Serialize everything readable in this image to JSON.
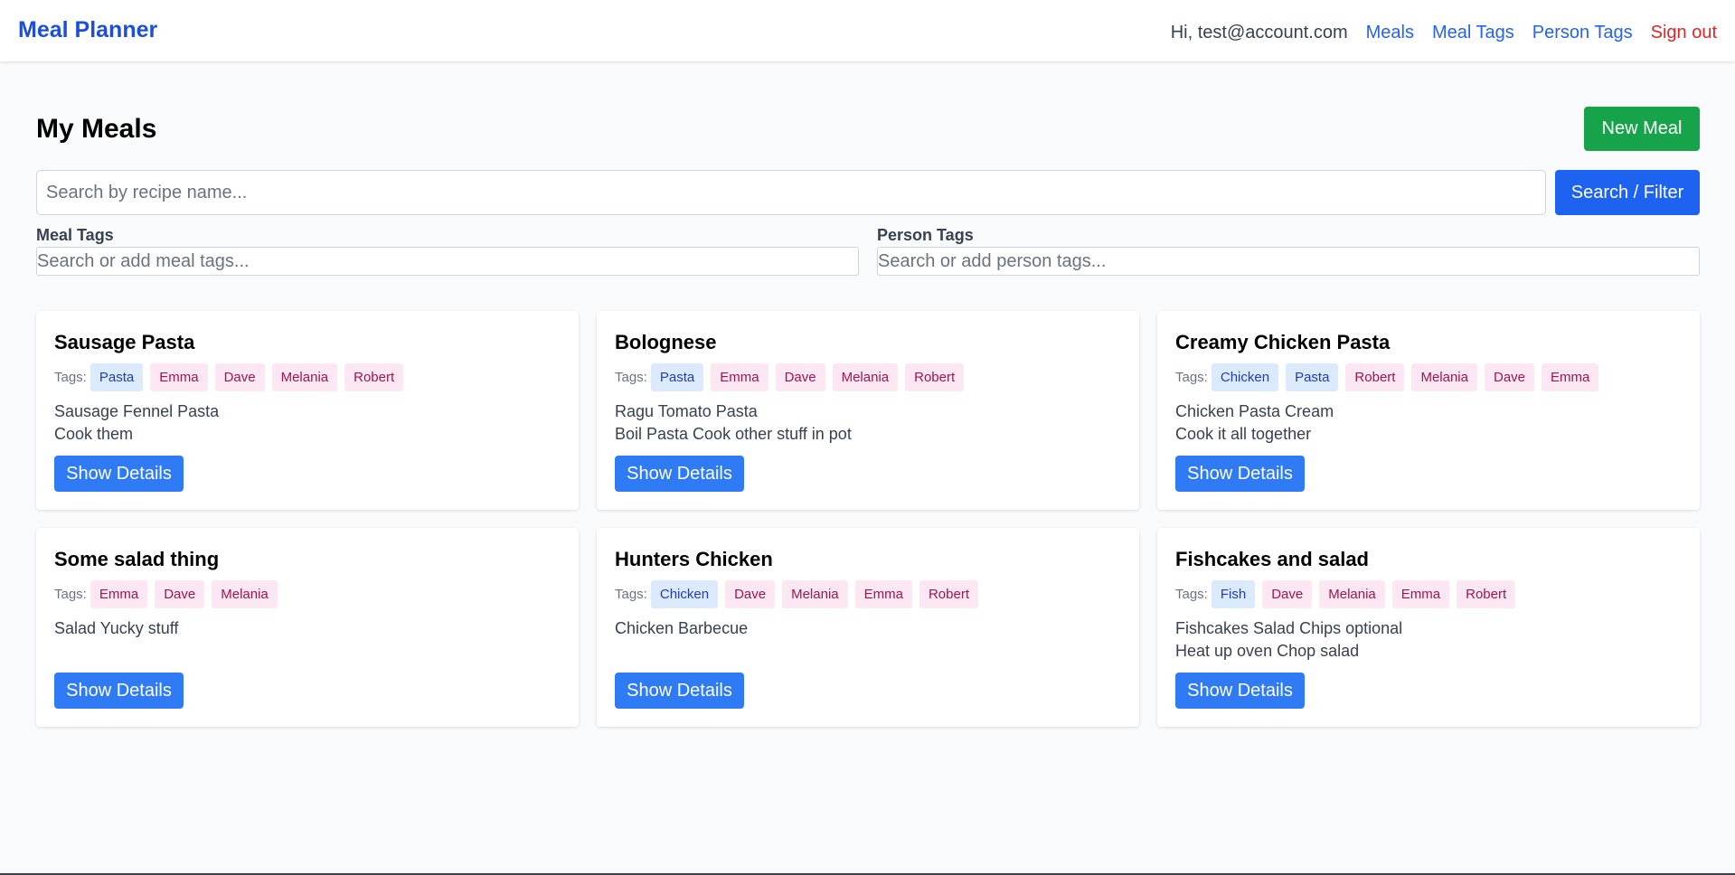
{
  "navbar": {
    "brand": "Meal Planner",
    "greeting": "Hi, test@account.com",
    "links": [
      "Meals",
      "Meal Tags",
      "Person Tags"
    ],
    "signout": "Sign out"
  },
  "page": {
    "title": "My Meals",
    "new_meal_label": "New Meal"
  },
  "search": {
    "placeholder": "Search by recipe name...",
    "value": "",
    "button_label": "Search / Filter"
  },
  "filters": {
    "meal_tags_label": "Meal Tags",
    "meal_tags_placeholder": "Search or add meal tags...",
    "person_tags_label": "Person Tags",
    "person_tags_placeholder": "Search or add person tags..."
  },
  "colors": {
    "accent": "#2563eb",
    "new_button": "#16a34a",
    "signout": "#dc2626",
    "meal_tag_bg": "#dbeafe",
    "person_tag_bg": "#fce7f3"
  },
  "meals": [
    {
      "title": "Sausage Pasta",
      "tags_label": "Tags:",
      "tags": [
        {
          "label": "Pasta",
          "kind": "meal"
        },
        {
          "label": "Emma",
          "kind": "person"
        },
        {
          "label": "Dave",
          "kind": "person"
        },
        {
          "label": "Melania",
          "kind": "person"
        },
        {
          "label": "Robert",
          "kind": "person"
        }
      ],
      "ingredients": "Sausage Fennel Pasta",
      "method": "Cook them",
      "button_label": "Show Details"
    },
    {
      "title": "Bolognese",
      "tags_label": "Tags:",
      "tags": [
        {
          "label": "Pasta",
          "kind": "meal"
        },
        {
          "label": "Emma",
          "kind": "person"
        },
        {
          "label": "Dave",
          "kind": "person"
        },
        {
          "label": "Melania",
          "kind": "person"
        },
        {
          "label": "Robert",
          "kind": "person"
        }
      ],
      "ingredients": "Ragu Tomato Pasta",
      "method": "Boil Pasta Cook other stuff in pot",
      "button_label": "Show Details"
    },
    {
      "title": "Creamy Chicken Pasta",
      "tags_label": "Tags:",
      "tags": [
        {
          "label": "Chicken",
          "kind": "meal"
        },
        {
          "label": "Pasta",
          "kind": "meal"
        },
        {
          "label": "Robert",
          "kind": "person"
        },
        {
          "label": "Melania",
          "kind": "person"
        },
        {
          "label": "Dave",
          "kind": "person"
        },
        {
          "label": "Emma",
          "kind": "person"
        }
      ],
      "ingredients": "Chicken Pasta Cream",
      "method": "Cook it all together",
      "button_label": "Show Details"
    },
    {
      "title": "Some salad thing",
      "tags_label": "Tags:",
      "tags": [
        {
          "label": "Emma",
          "kind": "person"
        },
        {
          "label": "Dave",
          "kind": "person"
        },
        {
          "label": "Melania",
          "kind": "person"
        }
      ],
      "ingredients": "Salad Yucky stuff",
      "method": "",
      "button_label": "Show Details"
    },
    {
      "title": "Hunters Chicken",
      "tags_label": "Tags:",
      "tags": [
        {
          "label": "Chicken",
          "kind": "meal"
        },
        {
          "label": "Dave",
          "kind": "person"
        },
        {
          "label": "Melania",
          "kind": "person"
        },
        {
          "label": "Emma",
          "kind": "person"
        },
        {
          "label": "Robert",
          "kind": "person"
        }
      ],
      "ingredients": "Chicken Barbecue",
      "method": "",
      "button_label": "Show Details"
    },
    {
      "title": "Fishcakes and salad",
      "tags_label": "Tags:",
      "tags": [
        {
          "label": "Fish",
          "kind": "meal"
        },
        {
          "label": "Dave",
          "kind": "person"
        },
        {
          "label": "Melania",
          "kind": "person"
        },
        {
          "label": "Emma",
          "kind": "person"
        },
        {
          "label": "Robert",
          "kind": "person"
        }
      ],
      "ingredients": "Fishcakes Salad Chips optional",
      "method": "Heat up oven Chop salad",
      "button_label": "Show Details"
    }
  ]
}
